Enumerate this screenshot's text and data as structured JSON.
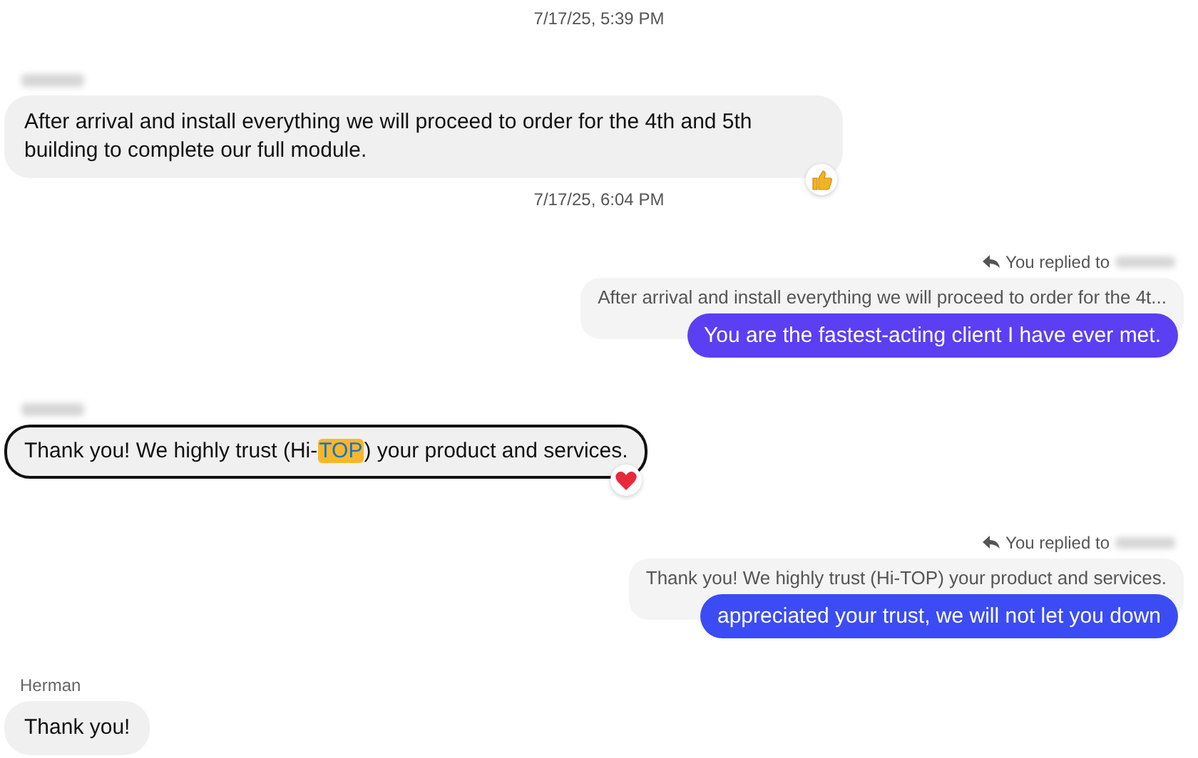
{
  "messages": [
    {
      "kind": "timestamp",
      "text": "7/17/25, 5:39 PM"
    },
    {
      "kind": "incoming",
      "sender_hidden": true,
      "text": [
        {
          "text": "After arrival and install everything we will proceed to order for the 4th and 5th building to complete our full module.",
          "highlighted": false
        }
      ],
      "selected": false,
      "reactions": [
        {
          "kind": "like"
        }
      ]
    },
    {
      "kind": "timestamp",
      "text": "7/17/25, 6:04 PM"
    },
    {
      "kind": "outgoing",
      "reply_label": "You replied to",
      "recipient_hidden": true,
      "quote": "After arrival and install everything we will proceed to order for the 4t...",
      "text": "You are the fastest-acting client I have ever met.",
      "color": "#5b3ff2"
    },
    {
      "kind": "incoming",
      "sender_hidden": true,
      "text": [
        {
          "text": "Thank you! We highly trust (Hi-",
          "highlighted": false
        },
        {
          "text": "TOP",
          "highlighted": true
        },
        {
          "text": ") your product and services.",
          "highlighted": false
        }
      ],
      "selected": true,
      "reactions": [
        {
          "kind": "love"
        }
      ]
    },
    {
      "kind": "outgoing",
      "reply_label": "You replied to",
      "recipient_hidden": true,
      "quote": "Thank you! We highly trust (Hi-TOP) your product and services.",
      "text": "appreciated your trust, we will not let you down",
      "color": "#3b4cf4"
    },
    {
      "kind": "incoming",
      "sender_hidden": false,
      "sender": "Herman",
      "text": [
        {
          "text": "Thank you!",
          "highlighted": false
        }
      ],
      "selected": false
    }
  ]
}
